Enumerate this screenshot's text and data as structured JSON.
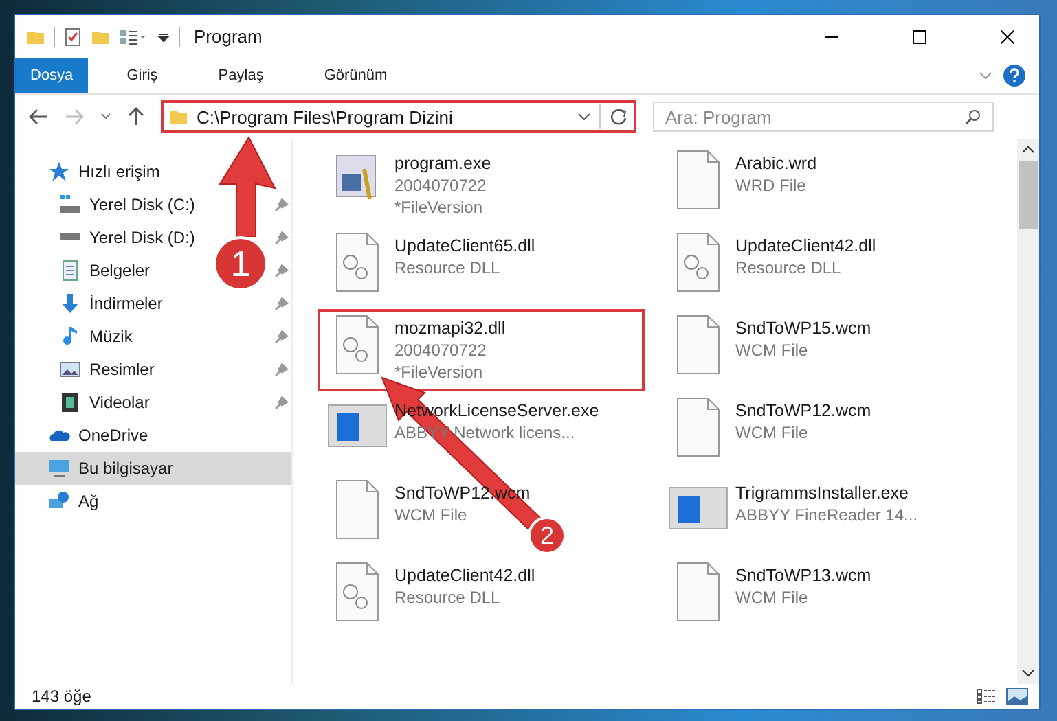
{
  "window": {
    "title": "Program"
  },
  "ribbon_tabs": [
    {
      "label": "Dosya",
      "selected": true
    },
    {
      "label": "Giriş",
      "selected": false
    },
    {
      "label": "Paylaş",
      "selected": false
    },
    {
      "label": "Görünüm",
      "selected": false
    }
  ],
  "address_bar": {
    "path": "C:\\Program Files\\Program Dizini",
    "highlighted": true
  },
  "search": {
    "placeholder": "Ara: Program"
  },
  "sidebar": {
    "items": [
      {
        "label": "Hızlı erişim",
        "kind": "star",
        "selected": false,
        "children": [
          {
            "label": "Yerel Disk (C:)",
            "kind": "drive-win",
            "pinned": true,
            "selected": false
          },
          {
            "label": "Yerel Disk (D:)",
            "kind": "drive",
            "pinned": true,
            "selected": false
          },
          {
            "label": "Belgeler",
            "kind": "document",
            "pinned": true,
            "selected": false
          },
          {
            "label": "İndirmeler",
            "kind": "download",
            "pinned": true,
            "selected": false
          },
          {
            "label": "Müzik",
            "kind": "music",
            "pinned": true,
            "selected": false
          },
          {
            "label": "Resimler",
            "kind": "picture",
            "pinned": true,
            "selected": false
          },
          {
            "label": "Videolar",
            "kind": "video",
            "pinned": true,
            "selected": false
          }
        ]
      },
      {
        "label": "OneDrive",
        "kind": "cloud",
        "selected": false
      },
      {
        "label": "Bu bilgisayar",
        "kind": "computer",
        "selected": true
      },
      {
        "label": "Ağ",
        "kind": "network",
        "selected": false
      }
    ]
  },
  "files": [
    {
      "name": "program.exe",
      "lines": [
        "2004070722",
        "*FileVersion"
      ],
      "kind": "exe",
      "highlighted": false
    },
    {
      "name": "Arabic.wrd",
      "lines": [
        "WRD File"
      ],
      "kind": "blank",
      "highlighted": false
    },
    {
      "name": "UpdateClient65.dll",
      "lines": [
        "Resource DLL"
      ],
      "kind": "dll",
      "highlighted": false
    },
    {
      "name": "UpdateClient42.dll",
      "lines": [
        "Resource DLL"
      ],
      "kind": "dll",
      "highlighted": false
    },
    {
      "name": "mozmapi32.dll",
      "lines": [
        "2004070722",
        "*FileVersion"
      ],
      "kind": "dll",
      "highlighted": true
    },
    {
      "name": "SndToWP15.wcm",
      "lines": [
        "WCM File"
      ],
      "kind": "blank",
      "highlighted": false
    },
    {
      "name": "NetworkLicenseServer.exe",
      "lines": [
        "ABBYY Network licens..."
      ],
      "kind": "installer",
      "highlighted": false
    },
    {
      "name": "SndToWP12.wcm",
      "lines": [
        "WCM File"
      ],
      "kind": "blank",
      "highlighted": false
    },
    {
      "name": "SndToWP12.wcm",
      "lines": [
        "WCM File"
      ],
      "kind": "blank",
      "highlighted": false
    },
    {
      "name": "TrigrammsInstaller.exe",
      "lines": [
        "ABBYY FineReader 14..."
      ],
      "kind": "installer",
      "highlighted": false
    },
    {
      "name": "UpdateClient42.dll",
      "lines": [
        "Resource DLL"
      ],
      "kind": "dll",
      "highlighted": false
    },
    {
      "name": "SndToWP13.wcm",
      "lines": [
        "WCM File"
      ],
      "kind": "blank",
      "highlighted": false
    }
  ],
  "status_bar": {
    "item_count": "143 öğe"
  },
  "annotations": [
    {
      "number": "1"
    },
    {
      "number": "2"
    }
  ]
}
